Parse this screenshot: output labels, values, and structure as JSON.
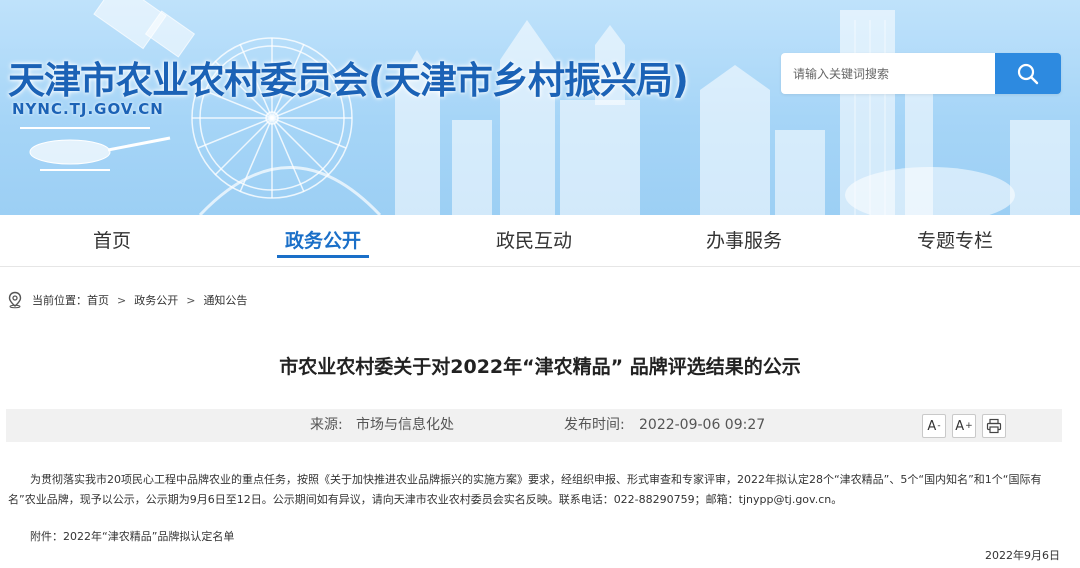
{
  "header": {
    "site_title": "天津市农业农村委员会(天津市乡村振兴局)",
    "site_domain": "NYNC.TJ.GOV.CN",
    "search": {
      "placeholder": "请输入关键词搜索",
      "icon": "search-icon"
    }
  },
  "nav": {
    "items": [
      {
        "label": "首页",
        "active": false
      },
      {
        "label": "政务公开",
        "active": true
      },
      {
        "label": "政民互动",
        "active": false
      },
      {
        "label": "办事服务",
        "active": false
      },
      {
        "label": "专题专栏",
        "active": false
      }
    ],
    "accent_color": "#1a6fc8"
  },
  "breadcrumb": {
    "icon": "location-pin-icon",
    "prefix": "当前位置：",
    "items": [
      "首页",
      "政务公开",
      "通知公告"
    ],
    "separator": ">"
  },
  "article": {
    "title": "市农业农村委关于对2022年“津农精品” 品牌评选结果的公示",
    "meta": {
      "source_label": "来源:",
      "source": "市场与信息化处",
      "time_label": "发布时间:",
      "time": "2022-09-06 09:27"
    },
    "tools": {
      "font_decrease": "A",
      "font_decrease_mark": "-",
      "font_increase": "A",
      "font_increase_mark": "+",
      "print_icon": "printer-icon"
    },
    "body": "为贯彻落实我市20项民心工程中品牌农业的重点任务，按照《关于加快推进农业品牌振兴的实施方案》要求，经组织申报、形式审查和专家评审，2022年拟认定28个“津农精品”、5个“国内知名”和1个“国际有名”农业品牌，现予以公示，公示期为9月6日至12日。公示期间如有异议，请向天津市农业农村委员会实名反映。联系电话：022-88290759；邮箱：tjnypp@tj.gov.cn。",
    "attachment": "附件：2022年“津农精品”品牌拟认定名单",
    "date": "2022年9月6日"
  }
}
